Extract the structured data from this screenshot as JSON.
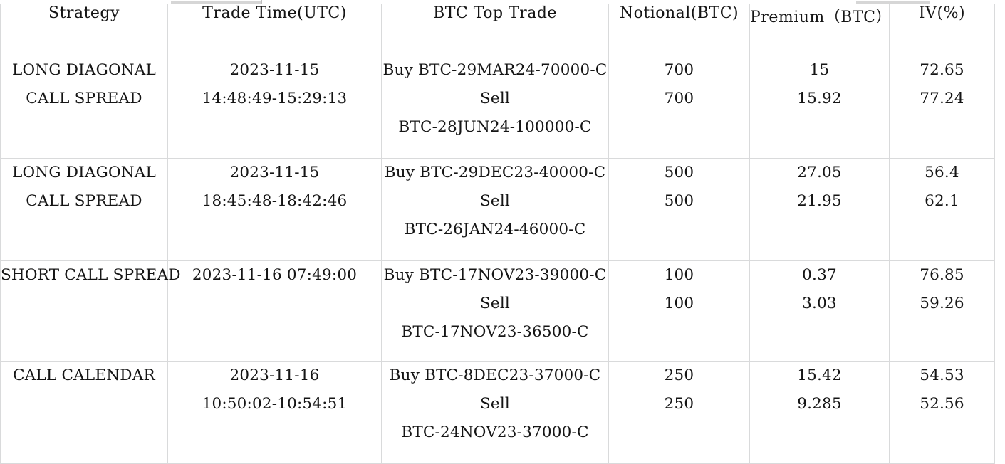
{
  "table": {
    "columns": [
      {
        "key": "strategy",
        "label": "Strategy"
      },
      {
        "key": "trade_time",
        "label": "Trade Time(UTC)"
      },
      {
        "key": "top_trade",
        "label": "BTC Top Trade"
      },
      {
        "key": "notional",
        "label": "Notional(BTC)"
      },
      {
        "key": "premium",
        "label": "Premium（BTC）"
      },
      {
        "key": "iv",
        "label": "IV(%)"
      }
    ],
    "rows": [
      {
        "strategy_line1": "LONG DIAGONAL",
        "strategy_line2": "CALL SPREAD",
        "time_line1": "2023-11-15",
        "time_line2": "14:48:49-15:29:13",
        "trade_line1": "Buy BTC-29MAR24-70000-C",
        "trade_line2": "Sell",
        "trade_line3": "BTC-28JUN24-100000-C",
        "notional_line1": "700",
        "notional_line2": "700",
        "premium_line1": "15",
        "premium_line2": "15.92",
        "iv_line1": "72.65",
        "iv_line2": "77.24"
      },
      {
        "strategy_line1": "LONG DIAGONAL",
        "strategy_line2": "CALL SPREAD",
        "time_line1": "2023-11-15",
        "time_line2": "18:45:48-18:42:46",
        "trade_line1": "Buy BTC-29DEC23-40000-C",
        "trade_line2": "Sell",
        "trade_line3": "BTC-26JAN24-46000-C",
        "notional_line1": "500",
        "notional_line2": "500",
        "premium_line1": "27.05",
        "premium_line2": "21.95",
        "iv_line1": "56.4",
        "iv_line2": "62.1"
      },
      {
        "strategy_line1": "SHORT CALL SPREAD",
        "strategy_line2": "",
        "time_line1": "2023-11-16 07:49:00",
        "time_line2": "",
        "trade_line1": "Buy BTC-17NOV23-39000-C",
        "trade_line2": "Sell",
        "trade_line3": "BTC-17NOV23-36500-C",
        "notional_line1": "100",
        "notional_line2": "100",
        "premium_line1": "0.37",
        "premium_line2": "3.03",
        "iv_line1": "76.85",
        "iv_line2": "59.26"
      },
      {
        "strategy_line1": "CALL CALENDAR",
        "strategy_line2": "",
        "time_line1": "2023-11-16",
        "time_line2": "10:50:02-10:54:51",
        "trade_line1": "Buy BTC-8DEC23-37000-C",
        "trade_line2": "Sell",
        "trade_line3": "BTC-24NOV23-37000-C",
        "notional_line1": "250",
        "notional_line2": "250",
        "premium_line1": "15.42",
        "premium_line2": "9.285",
        "iv_line1": "54.53",
        "iv_line2": "52.56"
      }
    ]
  },
  "colors": {
    "border": "#d9dadb",
    "text": "#151515",
    "background": "#ffffff"
  }
}
